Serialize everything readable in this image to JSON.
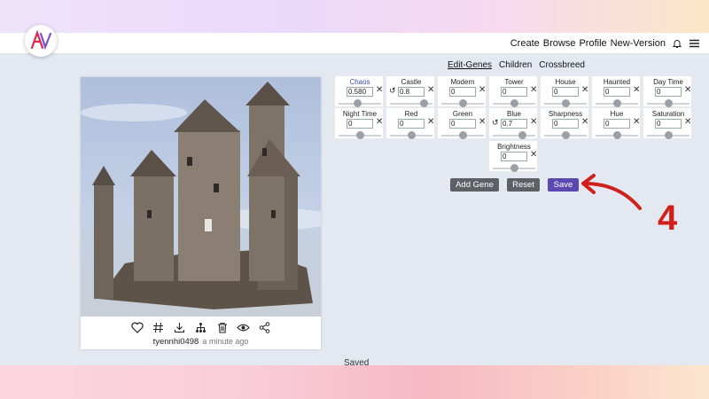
{
  "navbar": {
    "links": [
      "Create",
      "Browse",
      "Profile",
      "New-Version"
    ],
    "icons": [
      "bell-icon",
      "hamburger-menu-icon"
    ]
  },
  "brand": {
    "logo": "AV"
  },
  "card": {
    "image_alt": "castle",
    "actions": [
      "heart-icon",
      "hash-icon",
      "download-icon",
      "hierarchy-icon",
      "trash-icon",
      "eye-icon",
      "share-icon"
    ],
    "username": "tyennhi0498",
    "time": "a minute ago"
  },
  "tabs": {
    "edit_genes": "Edit-Genes",
    "children": "Children",
    "crossbreed": "Crossbreed",
    "active": "Edit-Genes"
  },
  "genes": [
    {
      "name": "Chaos",
      "value": "0.580",
      "slider": 0.45,
      "highlight": true,
      "undo": false
    },
    {
      "name": "Castle",
      "value": "0.8",
      "slider": 0.8,
      "highlight": false,
      "undo": true
    },
    {
      "name": "Modern",
      "value": "0",
      "slider": 0.5,
      "highlight": false,
      "undo": false
    },
    {
      "name": "Tower",
      "value": "0",
      "slider": 0.5,
      "highlight": false,
      "undo": false
    },
    {
      "name": "House",
      "value": "0",
      "slider": 0.5,
      "highlight": false,
      "undo": false
    },
    {
      "name": "Haunted",
      "value": "0",
      "slider": 0.5,
      "highlight": false,
      "undo": false
    },
    {
      "name": "Day Time",
      "value": "0",
      "slider": 0.5,
      "highlight": false,
      "undo": false
    },
    {
      "name": "Night Time",
      "value": "0",
      "slider": 0.5,
      "highlight": false,
      "undo": false
    },
    {
      "name": "Red",
      "value": "0",
      "slider": 0.5,
      "highlight": false,
      "undo": false
    },
    {
      "name": "Green",
      "value": "0",
      "slider": 0.5,
      "highlight": false,
      "undo": false
    },
    {
      "name": "Blue",
      "value": "0.7",
      "slider": 0.7,
      "highlight": false,
      "undo": true
    },
    {
      "name": "Sharpness",
      "value": "0",
      "slider": 0.5,
      "highlight": false,
      "undo": false
    },
    {
      "name": "Hue",
      "value": "0",
      "slider": 0.5,
      "highlight": false,
      "undo": false
    },
    {
      "name": "Saturation",
      "value": "0",
      "slider": 0.5,
      "highlight": false,
      "undo": false
    },
    {
      "name": "Brightness",
      "value": "0",
      "slider": 0.5,
      "highlight": false,
      "undo": false
    }
  ],
  "buttons": {
    "add_gene": "Add Gene",
    "reset": "Reset",
    "save": "Save"
  },
  "annotation": {
    "number": "4",
    "color": "#d0201c"
  },
  "status": "Saved",
  "colors": {
    "accent": "#5b49b0",
    "annotation_red": "#d0201c",
    "highlight_text": "#3646b3"
  }
}
